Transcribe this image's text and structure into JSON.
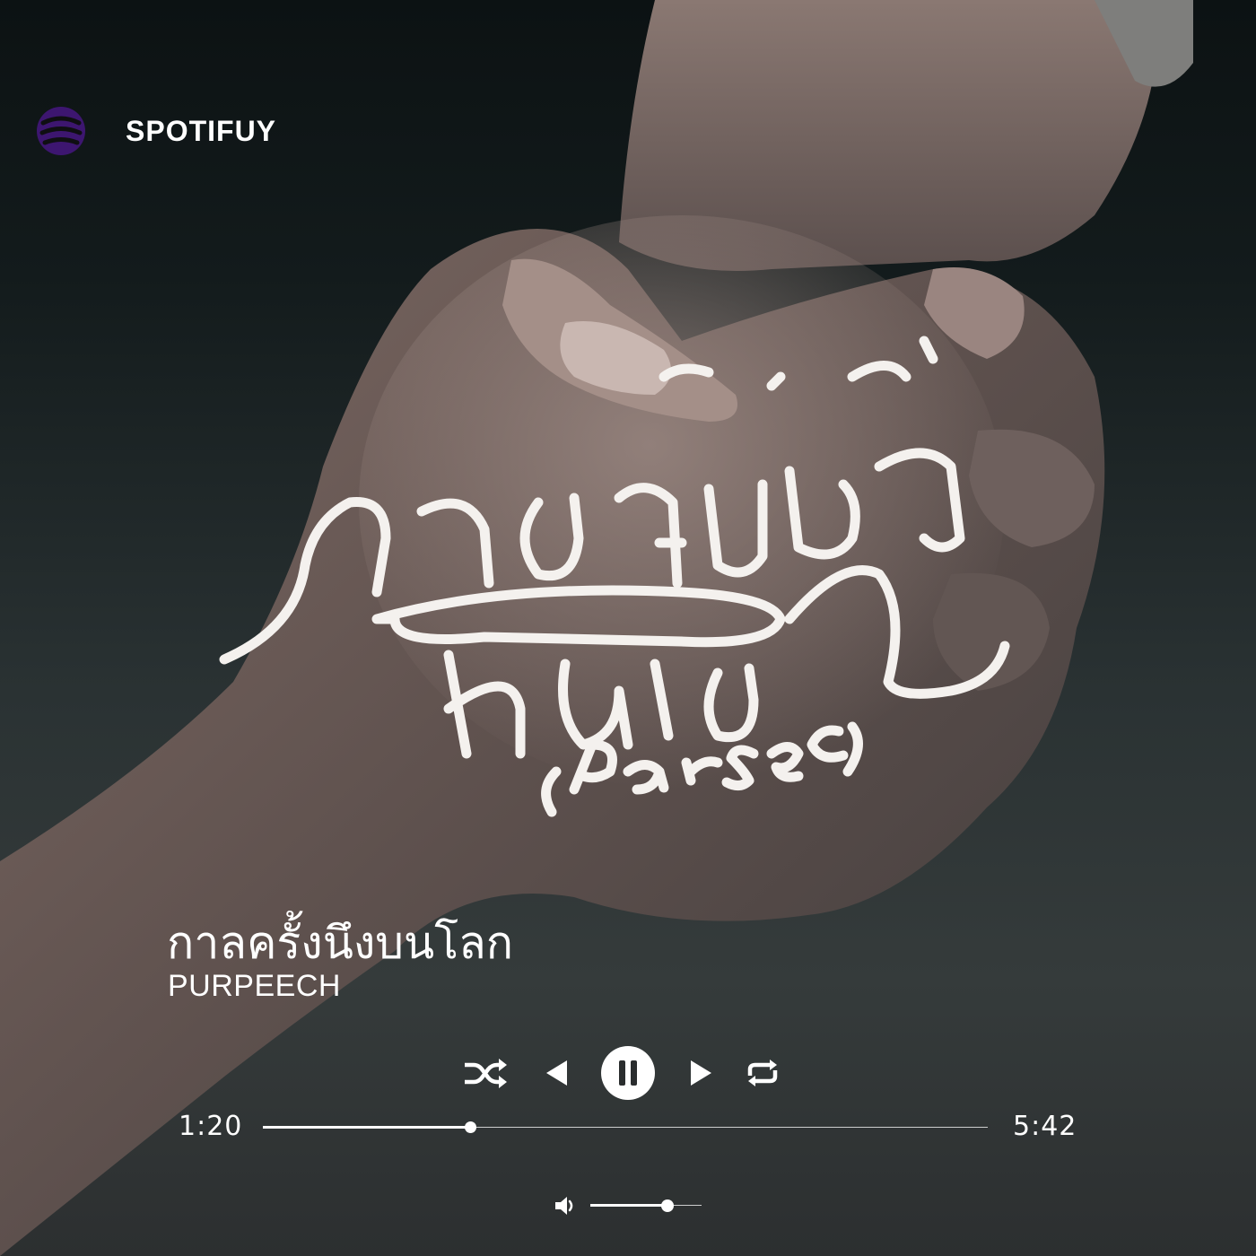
{
  "app": {
    "name": "SPOTIFUY"
  },
  "cover_art": {
    "lettering": "กาลครั้งหนึ่ง บนโลก (Parsec)",
    "description": "two clasped hands"
  },
  "track": {
    "title": "กาลครั้งนึงบนโลก",
    "artist": "PURPEECH"
  },
  "player": {
    "state": "playing",
    "elapsed": "1:20",
    "duration": "5:42",
    "progress_fraction": 0.286,
    "volume_fraction": 0.69,
    "controls": [
      "shuffle-icon",
      "previous-icon",
      "pause-icon",
      "next-icon",
      "repeat-icon"
    ]
  },
  "colors": {
    "logo": "#3d1670",
    "text": "#ffffff",
    "pause_button_bg": "#ffffff"
  }
}
